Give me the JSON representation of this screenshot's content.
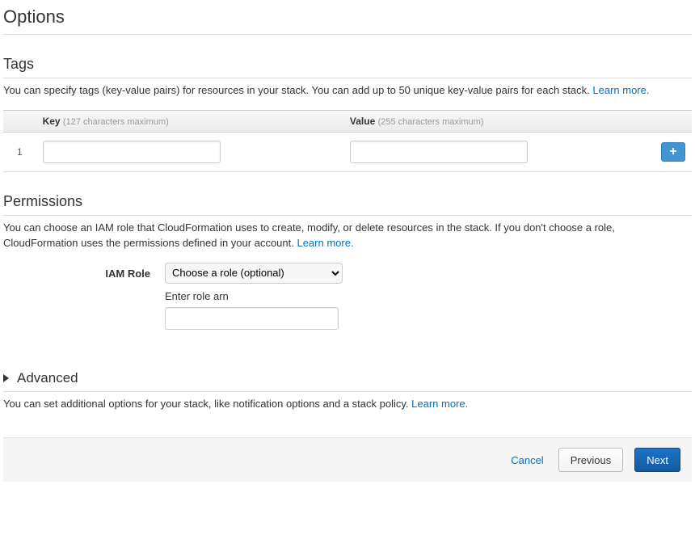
{
  "page": {
    "title": "Options"
  },
  "tags": {
    "heading": "Tags",
    "description": "You can specify tags (key-value pairs) for resources in your stack. You can add up to 50 unique key-value pairs for each stack. ",
    "learn_more": "Learn more.",
    "columns": {
      "key_label": "Key",
      "key_hint": "(127 characters maximum)",
      "value_label": "Value",
      "value_hint": "(255 characters maximum)"
    },
    "rows": [
      {
        "index": "1",
        "key": "",
        "value": ""
      }
    ],
    "add_label": "+"
  },
  "permissions": {
    "heading": "Permissions",
    "description": "You can choose an IAM role that CloudFormation uses to create, modify, or delete resources in the stack. If you don't choose a role, CloudFormation uses the permissions defined in your account. ",
    "learn_more": "Learn more.",
    "role_label": "IAM Role",
    "role_select_placeholder": "Choose a role (optional)",
    "role_arn_label": "Enter role arn",
    "role_arn_value": ""
  },
  "advanced": {
    "heading": "Advanced",
    "description": "You can set additional options for your stack, like notification options and a stack policy. ",
    "learn_more": "Learn more."
  },
  "footer": {
    "cancel": "Cancel",
    "previous": "Previous",
    "next": "Next"
  }
}
